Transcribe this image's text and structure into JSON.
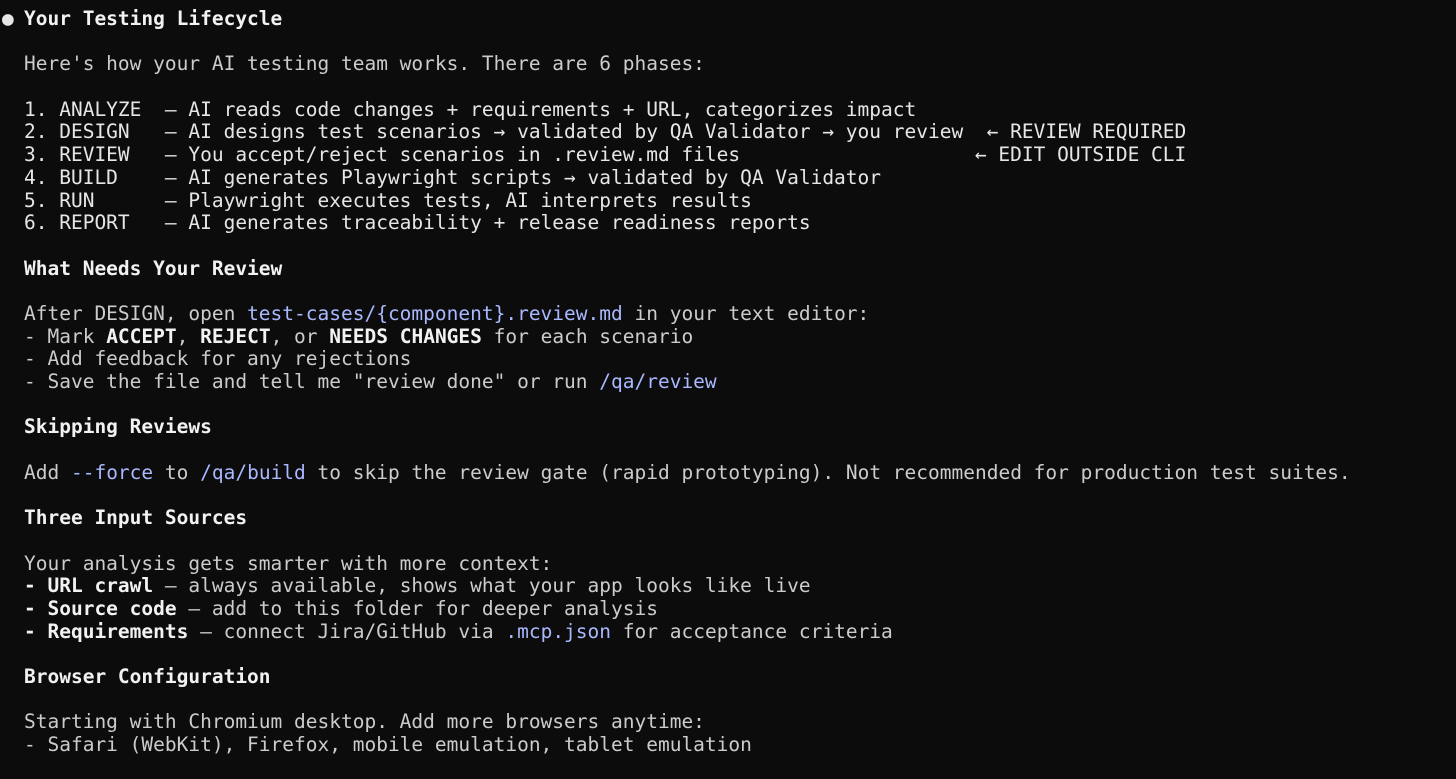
{
  "bullet": "●",
  "title": "Your Testing Lifecycle",
  "intro": "Here's how your AI testing team works. There are 6 phases:",
  "phases": [
    {
      "text": "1. ANALYZE  — AI reads code changes + requirements + URL, categorizes impact",
      "note": ""
    },
    {
      "text": "2. DESIGN   — AI designs test scenarios → validated by QA Validator → you review",
      "note": "← REVIEW REQUIRED"
    },
    {
      "text": "3. REVIEW   — You accept/reject scenarios in .review.md files",
      "note": "← EDIT OUTSIDE CLI"
    },
    {
      "text": "4. BUILD    — AI generates Playwright scripts → validated by QA Validator",
      "note": ""
    },
    {
      "text": "5. RUN      — Playwright executes tests, AI interprets results",
      "note": ""
    },
    {
      "text": "6. REPORT   — AI generates traceability + release readiness reports",
      "note": ""
    }
  ],
  "review_section": {
    "heading": "What Needs Your Review",
    "line1_pre": "After DESIGN, open ",
    "line1_path": "test-cases/{component}.review.md",
    "line1_post": " in your text editor:",
    "mark_pre": "- Mark ",
    "accept": "ACCEPT",
    "sep1": ", ",
    "reject": "REJECT",
    "sep2": ", or ",
    "needs": "NEEDS CHANGES",
    "mark_post": " for each scenario",
    "feedback": "- Add feedback for any rejections",
    "save_pre": "- Save the file and tell me \"review done\" or run ",
    "save_cmd": "/qa/review"
  },
  "skip_section": {
    "heading": "Skipping Reviews",
    "pre": "Add ",
    "force": "--force",
    "mid": " to ",
    "build": "/qa/build",
    "post": " to skip the review gate (rapid prototyping). Not recommended for production test suites."
  },
  "inputs_section": {
    "heading": "Three Input Sources",
    "intro": "Your analysis gets smarter with more context:",
    "url_label": "URL crawl",
    "url_text": " — always available, shows what your app looks like live",
    "source_label": "Source code",
    "source_text": " — add to this folder for deeper analysis",
    "req_label": "Requirements",
    "req_pre": " — connect Jira/GitHub via ",
    "req_file": ".mcp.json",
    "req_post": " for acceptance criteria"
  },
  "browser_section": {
    "heading": "Browser Configuration",
    "line1": "Starting with Chromium desktop. Add more browsers anytime:",
    "line2": "- Safari (WebKit), Firefox, mobile emulation, tablet emulation"
  },
  "colors": {
    "background": "#0c0c0c",
    "text": "#cccccc",
    "emphasis": "#f2f2f2",
    "command": "#a9b8ff"
  }
}
